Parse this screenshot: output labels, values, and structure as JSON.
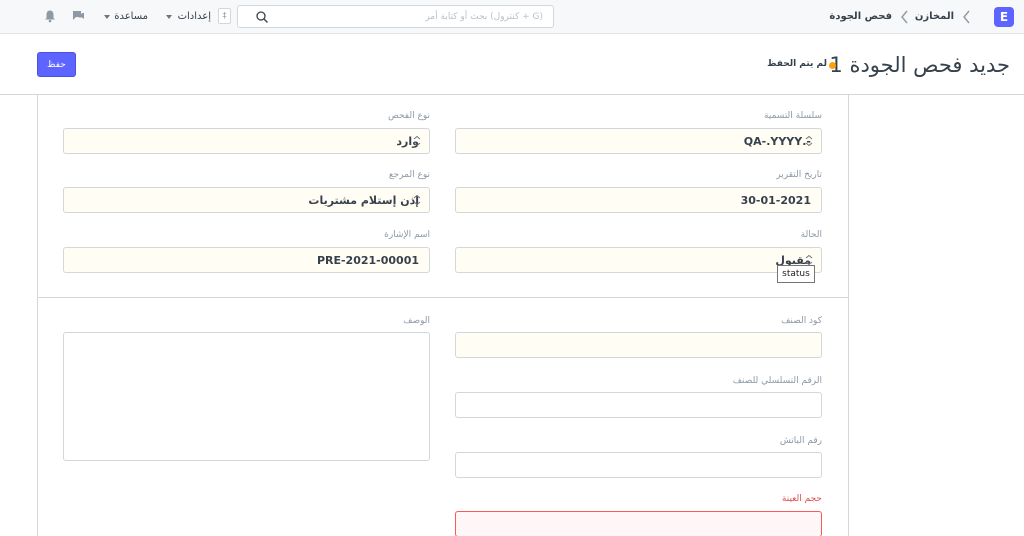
{
  "navbar": {
    "logo_letter": "E",
    "breadcrumbs": [
      "المخازن",
      "فحص الجودة"
    ],
    "search_placeholder": "بحث أو كتابة أمر (كنترول + G)",
    "shortcut_key": "‡",
    "settings_label": "إعدادات",
    "help_label": "مساعدة",
    "icons": [
      "search-icon",
      "chat-icon",
      "bell-icon",
      "chevron-left-icon"
    ]
  },
  "page": {
    "title": "جديد فحص الجودة 1",
    "status": "لم يتم الحفظ",
    "save_label": "حفظ",
    "status_color": "#ffa00a",
    "accent_color": "#5e64ff"
  },
  "form": {
    "naming_series": {
      "label": "سلسلة التسمية",
      "value": "-.QA-.YYYY"
    },
    "inspection_type": {
      "label": "نوع الفحص",
      "value": "وارد"
    },
    "report_date": {
      "label": "تاريخ التقرير",
      "value": "30-01-2021"
    },
    "reference_type": {
      "label": "نوع المرجع",
      "value": "إذن إستلام مشتريات"
    },
    "status": {
      "label": "الحالة",
      "value": "مقبول",
      "tooltip": "status"
    },
    "reference_name": {
      "label": "اسم الإشارة",
      "value": "PRE-2021-00001"
    },
    "item_code": {
      "label": "كود الصنف",
      "value": ""
    },
    "description": {
      "label": "الوصف",
      "value": ""
    },
    "item_serial_no": {
      "label": "الرقم التسلسلي للصنف",
      "value": ""
    },
    "batch_no": {
      "label": "رقم الباتش",
      "value": ""
    },
    "sample_size": {
      "label": "حجم العينة",
      "value": ""
    }
  }
}
